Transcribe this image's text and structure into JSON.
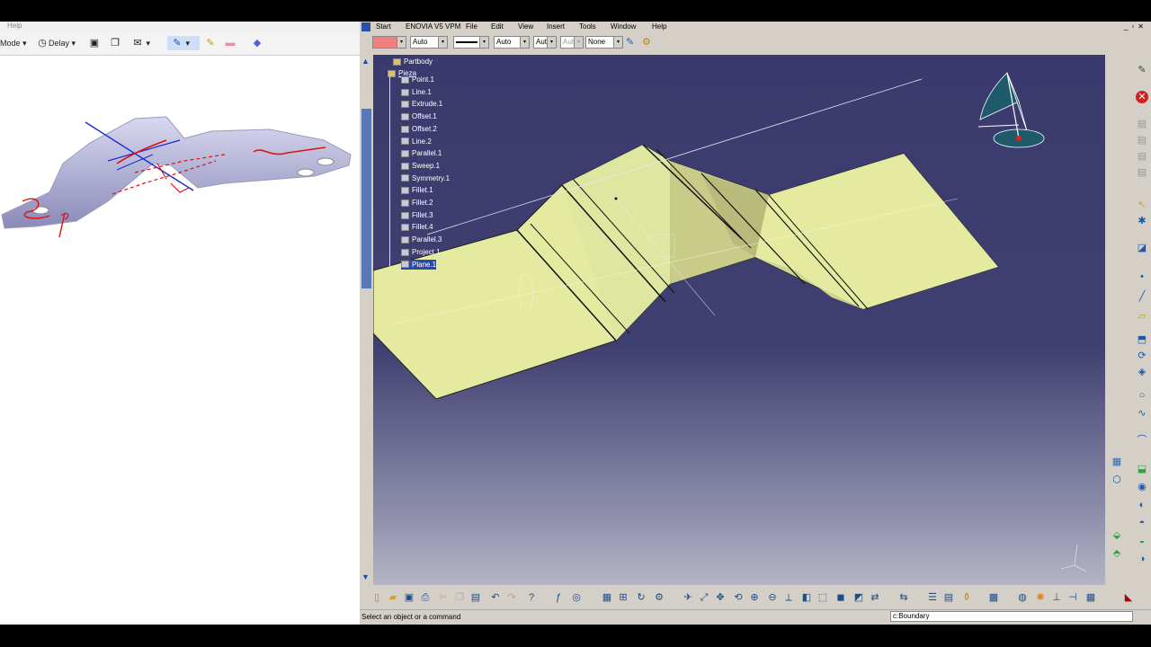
{
  "snip": {
    "menu_help": "Help",
    "mode_label": "Mode",
    "delay_label": "Delay"
  },
  "catia": {
    "menu": [
      "Start",
      "ENOVIA V5 VPM",
      "File",
      "Edit",
      "View",
      "Insert",
      "Tools",
      "Window",
      "Help"
    ],
    "graphic_props": {
      "line_type": "Auto",
      "thickness": "Auto",
      "layer_a": "Aut",
      "layer_b": "Aut",
      "render": "None"
    },
    "tree": {
      "root": "Partbody",
      "part": "Pieza",
      "items": [
        "Point.1",
        "Line.1",
        "Extrude.1",
        "Offset.1",
        "Offset.2",
        "Line.2",
        "Parallel.1",
        "Sweep.1",
        "Symmetry.1",
        "Fillet.1",
        "Fillet.2",
        "Fillet.3",
        "Fillet.4",
        "Parallel.3",
        "Project.1",
        "Plane.1"
      ]
    },
    "status_message": "Select an object or a command",
    "command_field": "c:Boundary",
    "colors": {
      "surface": "#e6eca0",
      "background_top": "#3a3a6e",
      "accent_red": "#e02020"
    }
  }
}
